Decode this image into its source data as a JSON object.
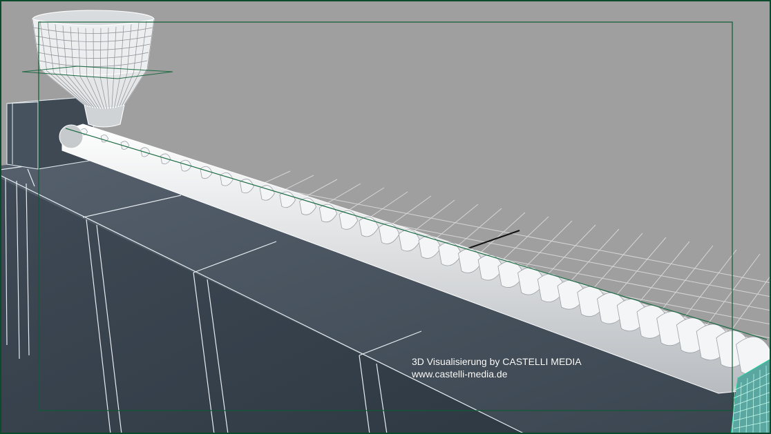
{
  "viewport": {
    "background_color": "#9f9f9f",
    "frame_color": "#0b4a2c",
    "grid_color": "#d8d8d8",
    "body_color": "#3c4853",
    "wire_color": "#ffffff",
    "selection_color": "#21d59a"
  },
  "watermark": {
    "line1": "3D Visualisierung by CASTELLI MEDIA",
    "line2": "www.castelli-media.de"
  }
}
